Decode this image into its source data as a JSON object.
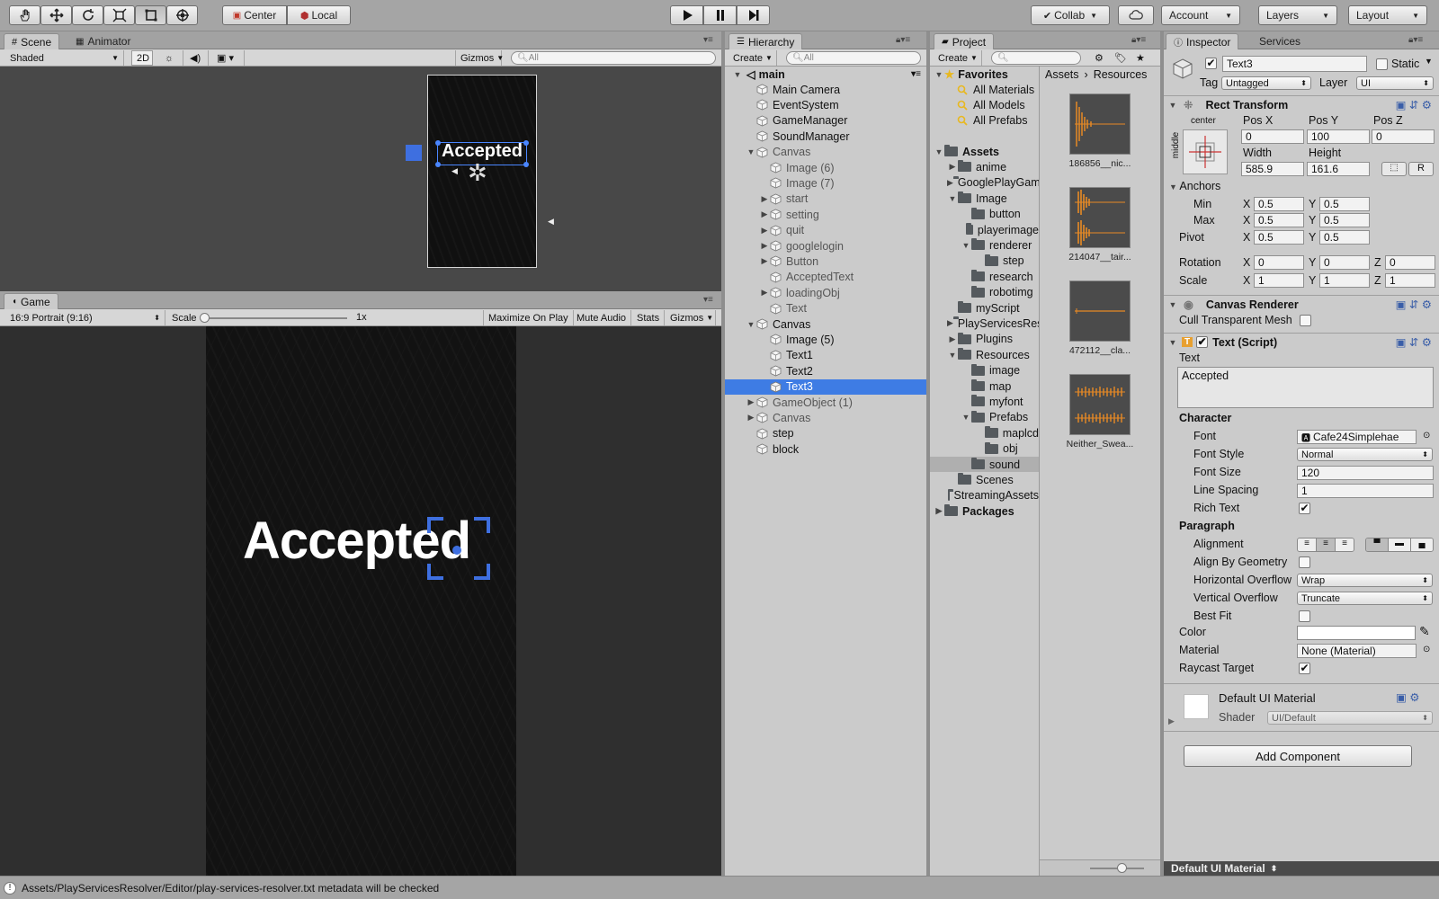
{
  "toolbar": {
    "tools": [
      "hand-tool",
      "move-tool",
      "rotate-tool",
      "scale-tool",
      "rect-tool",
      "transform-tool"
    ],
    "pivot_mode": "Center",
    "pivot_space": "Local",
    "collab_label": "Collab",
    "account_label": "Account",
    "layers_label": "Layers",
    "layout_label": "Layout"
  },
  "scene_panel": {
    "tabs": [
      "Scene",
      "Animator"
    ],
    "shading": "Shaded",
    "mode_2d": "2D",
    "gizmos": "Gizmos",
    "search_placeholder": "All",
    "scene_text": "Accepted"
  },
  "game_panel": {
    "tab": "Game",
    "aspect": "16:9 Portrait (9:16)",
    "scale_label": "Scale",
    "scale_value": "1x",
    "maximize": "Maximize On Play",
    "mute": "Mute Audio",
    "stats": "Stats",
    "gizmos": "Gizmos",
    "game_text": "Accepted"
  },
  "hierarchy": {
    "tab": "Hierarchy",
    "create": "Create",
    "search_placeholder": "All",
    "scene_name": "main",
    "items": [
      {
        "label": "Main Camera",
        "depth": 1,
        "arrow": "",
        "dim": false
      },
      {
        "label": "EventSystem",
        "depth": 1,
        "arrow": "",
        "dim": false
      },
      {
        "label": "GameManager",
        "depth": 1,
        "arrow": "",
        "dim": false
      },
      {
        "label": "SoundManager",
        "depth": 1,
        "arrow": "",
        "dim": false
      },
      {
        "label": "Canvas",
        "depth": 1,
        "arrow": "open",
        "dim": true
      },
      {
        "label": "Image (6)",
        "depth": 2,
        "arrow": "",
        "dim": true
      },
      {
        "label": "Image (7)",
        "depth": 2,
        "arrow": "",
        "dim": true
      },
      {
        "label": "start",
        "depth": 2,
        "arrow": "closed",
        "dim": true
      },
      {
        "label": "setting",
        "depth": 2,
        "arrow": "closed",
        "dim": true
      },
      {
        "label": "quit",
        "depth": 2,
        "arrow": "closed",
        "dim": true
      },
      {
        "label": "googlelogin",
        "depth": 2,
        "arrow": "closed",
        "dim": true
      },
      {
        "label": "Button",
        "depth": 2,
        "arrow": "closed",
        "dim": true
      },
      {
        "label": "AcceptedText",
        "depth": 2,
        "arrow": "",
        "dim": true
      },
      {
        "label": "loadingObj",
        "depth": 2,
        "arrow": "closed",
        "dim": true
      },
      {
        "label": "Text",
        "depth": 2,
        "arrow": "",
        "dim": true
      },
      {
        "label": "Canvas",
        "depth": 1,
        "arrow": "open",
        "dim": false
      },
      {
        "label": "Image (5)",
        "depth": 2,
        "arrow": "",
        "dim": false
      },
      {
        "label": "Text1",
        "depth": 2,
        "arrow": "",
        "dim": false
      },
      {
        "label": "Text2",
        "depth": 2,
        "arrow": "",
        "dim": false
      },
      {
        "label": "Text3",
        "depth": 2,
        "arrow": "",
        "dim": false,
        "selected": true
      },
      {
        "label": "GameObject (1)",
        "depth": 1,
        "arrow": "closed",
        "dim": true
      },
      {
        "label": "Canvas",
        "depth": 1,
        "arrow": "closed",
        "dim": true
      },
      {
        "label": "step",
        "depth": 1,
        "arrow": "",
        "dim": false
      },
      {
        "label": "block",
        "depth": 1,
        "arrow": "",
        "dim": false
      }
    ]
  },
  "project": {
    "tab": "Project",
    "create": "Create",
    "favorites_label": "Favorites",
    "favorites": [
      "All Materials",
      "All Models",
      "All Prefabs"
    ],
    "tree": [
      {
        "label": "Assets",
        "depth": 0,
        "arrow": "open",
        "bold": true
      },
      {
        "label": "anime",
        "depth": 1,
        "arrow": "closed"
      },
      {
        "label": "GooglePlayGames",
        "depth": 1,
        "arrow": "closed"
      },
      {
        "label": "Image",
        "depth": 1,
        "arrow": "open"
      },
      {
        "label": "button",
        "depth": 2,
        "arrow": ""
      },
      {
        "label": "playerimage",
        "depth": 2,
        "arrow": ""
      },
      {
        "label": "renderer",
        "depth": 2,
        "arrow": "open"
      },
      {
        "label": "step",
        "depth": 3,
        "arrow": ""
      },
      {
        "label": "research",
        "depth": 2,
        "arrow": ""
      },
      {
        "label": "robotimg",
        "depth": 2,
        "arrow": ""
      },
      {
        "label": "myScript",
        "depth": 1,
        "arrow": ""
      },
      {
        "label": "PlayServicesResolver",
        "depth": 1,
        "arrow": "closed"
      },
      {
        "label": "Plugins",
        "depth": 1,
        "arrow": "closed"
      },
      {
        "label": "Resources",
        "depth": 1,
        "arrow": "open"
      },
      {
        "label": "image",
        "depth": 2,
        "arrow": ""
      },
      {
        "label": "map",
        "depth": 2,
        "arrow": ""
      },
      {
        "label": "myfont",
        "depth": 2,
        "arrow": ""
      },
      {
        "label": "Prefabs",
        "depth": 2,
        "arrow": "open"
      },
      {
        "label": "maplcd",
        "depth": 3,
        "arrow": ""
      },
      {
        "label": "obj",
        "depth": 3,
        "arrow": ""
      },
      {
        "label": "sound",
        "depth": 2,
        "arrow": "",
        "hilite": true
      },
      {
        "label": "Scenes",
        "depth": 1,
        "arrow": ""
      },
      {
        "label": "StreamingAssets",
        "depth": 1,
        "arrow": ""
      },
      {
        "label": "Packages",
        "depth": 0,
        "arrow": "closed",
        "bold": true
      }
    ],
    "breadcrumb": [
      "Assets",
      "Resources"
    ],
    "files": [
      "186856__nic...",
      "214047__tair...",
      "472112__cla...",
      "Neither_Swea..."
    ]
  },
  "inspector": {
    "tabs": [
      "Inspector",
      "Services"
    ],
    "object_name": "Text3",
    "static_label": "Static",
    "tag_label": "Tag",
    "tag_value": "Untagged",
    "layer_label": "Layer",
    "layer_value": "UI",
    "rect_transform": {
      "title": "Rect Transform",
      "anchor_h": "center",
      "anchor_v": "middle",
      "posx_label": "Pos X",
      "posx": "0",
      "posy_label": "Pos Y",
      "posy": "100",
      "posz_label": "Pos Z",
      "posz": "0",
      "width_label": "Width",
      "width": "585.9",
      "height_label": "Height",
      "height": "161.6",
      "anchors_label": "Anchors",
      "min_label": "Min",
      "min_x": "0.5",
      "min_y": "0.5",
      "max_label": "Max",
      "max_x": "0.5",
      "max_y": "0.5",
      "pivot_label": "Pivot",
      "pivot_x": "0.5",
      "pivot_y": "0.5",
      "rotation_label": "Rotation",
      "rot_x": "0",
      "rot_y": "0",
      "rot_z": "0",
      "scale_label": "Scale",
      "scale_x": "1",
      "scale_y": "1",
      "scale_z": "1",
      "x": "X",
      "y": "Y",
      "z": "Z",
      "r_button": "R"
    },
    "canvas_renderer": {
      "title": "Canvas Renderer",
      "cull_label": "Cull Transparent Mesh"
    },
    "text_script": {
      "title": "Text (Script)",
      "text_label": "Text",
      "text_value": "Accepted",
      "character_label": "Character",
      "font_label": "Font",
      "font_value": "Cafe24Simplehae",
      "font_style_label": "Font Style",
      "font_style_value": "Normal",
      "font_size_label": "Font Size",
      "font_size_value": "120",
      "line_spacing_label": "Line Spacing",
      "line_spacing_value": "1",
      "rich_text_label": "Rich Text",
      "paragraph_label": "Paragraph",
      "alignment_label": "Alignment",
      "align_geom_label": "Align By Geometry",
      "h_overflow_label": "Horizontal Overflow",
      "h_overflow_value": "Wrap",
      "v_overflow_label": "Vertical Overflow",
      "v_overflow_value": "Truncate",
      "best_fit_label": "Best Fit",
      "color_label": "Color",
      "material_label": "Material",
      "material_value": "None (Material)",
      "raycast_label": "Raycast Target"
    },
    "material": {
      "title": "Default UI Material",
      "shader_label": "Shader",
      "shader_value": "UI/Default"
    },
    "add_component": "Add Component",
    "footer_label": "Default UI Material"
  },
  "status_bar": {
    "message": "Assets/PlayServicesResolver/Editor/play-services-resolver.txt metadata will be checked"
  },
  "colors": {
    "selection": "#3e7ce4",
    "accent_blue": "#3e6fe0",
    "audio_orange": "#e88a24"
  }
}
